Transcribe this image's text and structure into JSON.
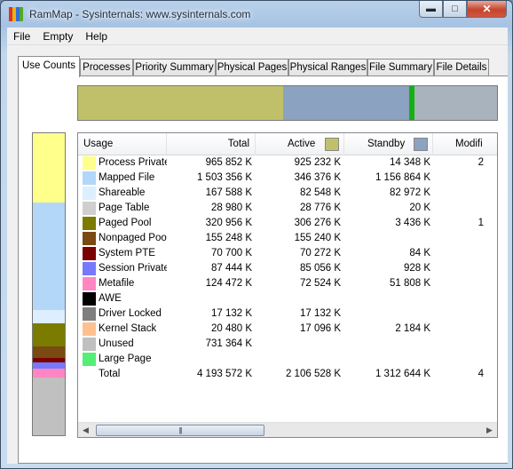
{
  "window": {
    "title": "RamMap - Sysinternals: www.sysinternals.com"
  },
  "title_icon_colors": [
    "#e0312c",
    "#e9b40d",
    "#2f6fd6",
    "#54a82c"
  ],
  "menu": [
    "File",
    "Empty",
    "Help"
  ],
  "tabs": [
    {
      "label": "Use Counts",
      "active": true
    },
    {
      "label": "Processes"
    },
    {
      "label": "Priority Summary"
    },
    {
      "label": "Physical Pages"
    },
    {
      "label": "Physical Ranges"
    },
    {
      "label": "File Summary"
    },
    {
      "label": "File Details"
    }
  ],
  "colors": {
    "active": "#c0c06a",
    "standby": "#8ba2c0",
    "free_marker": "#14b014",
    "remaining": "#a9b3bd"
  },
  "summary_bar": [
    {
      "name": "active",
      "fraction": 0.49,
      "color": "#c0c06a"
    },
    {
      "name": "standby",
      "fraction": 0.3,
      "color": "#8ba2c0"
    },
    {
      "name": "free",
      "fraction": 0.012,
      "color": "#14b014"
    },
    {
      "name": "other",
      "fraction": 0.198,
      "color": "#a9b3bd"
    }
  ],
  "side_bar": [
    {
      "name": "Process Private",
      "fraction": 0.23,
      "color": "#ffff8c"
    },
    {
      "name": "Mapped File",
      "fraction": 0.355,
      "color": "#b2d7f9"
    },
    {
      "name": "Shareable",
      "fraction": 0.045,
      "color": "#ddeeff"
    },
    {
      "name": "Paged Pool",
      "fraction": 0.075,
      "color": "#7b7b00"
    },
    {
      "name": "Nonpaged Pool",
      "fraction": 0.038,
      "color": "#7a4a12"
    },
    {
      "name": "System PTE",
      "fraction": 0.017,
      "color": "#7b0000"
    },
    {
      "name": "Session Private",
      "fraction": 0.02,
      "color": "#7878ff"
    },
    {
      "name": "Metafile",
      "fraction": 0.03,
      "color": "#ff86c2"
    },
    {
      "name": "Unused",
      "fraction": 0.19,
      "color": "#c0c0c0"
    }
  ],
  "columns": {
    "usage": "Usage",
    "total": "Total",
    "active": "Active",
    "standby": "Standby",
    "modified": "Modifi"
  },
  "rows": [
    {
      "label": "Process Private",
      "color": "#ffff8c",
      "total": "965 852 K",
      "active": "925 232 K",
      "standby": "14 348 K",
      "modified": "2"
    },
    {
      "label": "Mapped File",
      "color": "#b2d7f9",
      "total": "1 503 356 K",
      "active": "346 376 K",
      "standby": "1 156 864 K",
      "modified": ""
    },
    {
      "label": "Shareable",
      "color": "#ddeeff",
      "total": "167 588 K",
      "active": "82 548 K",
      "standby": "82 972 K",
      "modified": ""
    },
    {
      "label": "Page Table",
      "color": "#cfcfcf",
      "total": "28 980 K",
      "active": "28 776 K",
      "standby": "20 K",
      "modified": ""
    },
    {
      "label": "Paged Pool",
      "color": "#7b7b00",
      "total": "320 956 K",
      "active": "306 276 K",
      "standby": "3 436 K",
      "modified": "1"
    },
    {
      "label": "Nonpaged Pool",
      "color": "#7a4a12",
      "total": "155 248 K",
      "active": "155 240 K",
      "standby": "",
      "modified": ""
    },
    {
      "label": "System PTE",
      "color": "#7b0000",
      "total": "70 700 K",
      "active": "70 272 K",
      "standby": "84 K",
      "modified": ""
    },
    {
      "label": "Session Private",
      "color": "#7878ff",
      "total": "87 444 K",
      "active": "85 056 K",
      "standby": "928 K",
      "modified": ""
    },
    {
      "label": "Metafile",
      "color": "#ff86c2",
      "total": "124 472 K",
      "active": "72 524 K",
      "standby": "51 808 K",
      "modified": ""
    },
    {
      "label": "AWE",
      "color": "#000000",
      "total": "",
      "active": "",
      "standby": "",
      "modified": ""
    },
    {
      "label": "Driver Locked",
      "color": "#7f7f7f",
      "total": "17 132 K",
      "active": "17 132 K",
      "standby": "",
      "modified": ""
    },
    {
      "label": "Kernel Stack",
      "color": "#ffc090",
      "total": "20 480 K",
      "active": "17 096 K",
      "standby": "2 184 K",
      "modified": ""
    },
    {
      "label": "Unused",
      "color": "#c0c0c0",
      "total": "731 364 K",
      "active": "",
      "standby": "",
      "modified": ""
    },
    {
      "label": "Large Page",
      "color": "#55ee77",
      "total": "",
      "active": "",
      "standby": "",
      "modified": ""
    },
    {
      "label": "Total",
      "color": "",
      "total": "4 193 572 K",
      "active": "2 106 528 K",
      "standby": "1 312 644 K",
      "modified": "4"
    }
  ]
}
